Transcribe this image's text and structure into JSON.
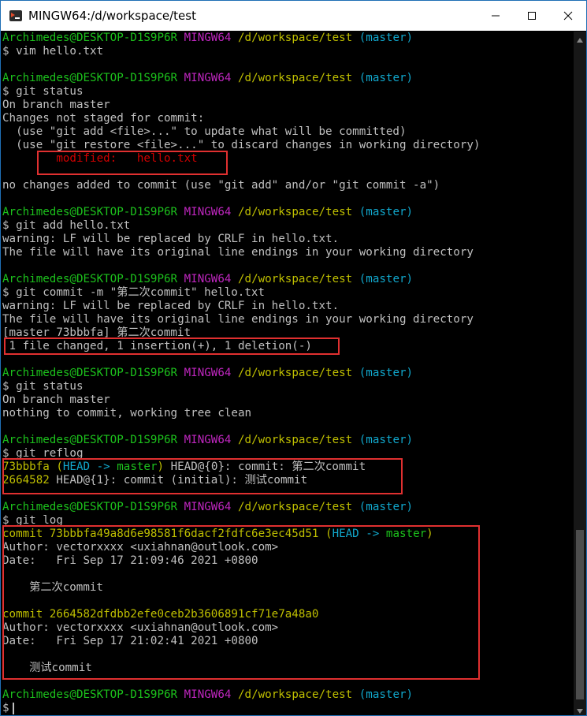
{
  "window": {
    "title": "MINGW64:/d/workspace/test"
  },
  "prompt": {
    "user": "Archimedes@DESKTOP-D1S9P6R",
    "env": "MINGW64",
    "path": "/d/workspace/test",
    "branch": "(master)",
    "symbol": "$"
  },
  "lines": {
    "c1": "$ vim hello.txt",
    "c2": "$ git status",
    "s1": "On branch master",
    "s2": "Changes not staged for commit:",
    "s3": "  (use \"git add <file>...\" to update what will be committed)",
    "s4": "  (use \"git restore <file>...\" to discard changes in working directory)",
    "s5": "        modified:   hello.txt",
    "s6": "no changes added to commit (use \"git add\" and/or \"git commit -a\")",
    "c3": "$ git add hello.txt",
    "w1": "warning: LF will be replaced by CRLF in hello.txt.",
    "w2": "The file will have its original line endings in your working directory",
    "c4": "$ git commit -m \"第二次commit\" hello.txt",
    "w3": "warning: LF will be replaced by CRLF in hello.txt.",
    "w4": "The file will have its original line endings in your working directory",
    "m1": "[master 73bbbfa] 第二次commit",
    "m2": " 1 file changed, 1 insertion(+), 1 deletion(-)",
    "c5": "$ git status",
    "t1": "On branch master",
    "t2": "nothing to commit, working tree clean",
    "c6": "$ git reflog",
    "r1_hash": "73bbbfa",
    "r1_open": " (",
    "r1_head": "HEAD -> ",
    "r1_branch": "master",
    "r1_close": ")",
    "r1_rest": " HEAD@{0}: commit: 第二次commit",
    "r2_hash": "2664582",
    "r2_rest": " HEAD@{1}: commit (initial): 测试commit",
    "c7": "$ git log",
    "l1_commit": "commit 73bbbfa49a8d6e98581f6dacf2fdfc6e3ec45d51",
    "l1_open": " (",
    "l1_head": "HEAD -> ",
    "l1_branch": "master",
    "l1_close": ")",
    "l1_author": "Author: vectorxxxx <uxiahnan@outlook.com>",
    "l1_date": "Date:   Fri Sep 17 21:09:46 2021 +0800",
    "l1_msg": "    第二次commit",
    "l2_commit": "commit 2664582dfdbb2efe0ceb2b3606891cf71e7a48a0",
    "l2_author": "Author: vectorxxxx <uxiahnan@outlook.com>",
    "l2_date": "Date:   Fri Sep 17 21:02:41 2021 +0800",
    "l2_msg": "    测试commit",
    "c8": "$"
  },
  "colors": {
    "prompt_user": "#1cc11c",
    "prompt_env": "#bf26bf",
    "prompt_path": "#bfbf00",
    "prompt_branch": "#11a8cd",
    "modified": "#d20000",
    "highlight_box": "#e03030",
    "terminal_bg": "#000000",
    "terminal_fg": "#c0c0c0"
  },
  "icons": {
    "app": "git-bash-icon",
    "minimize": "minimize-icon",
    "maximize": "maximize-icon",
    "close": "close-icon",
    "scroll_up": "scroll-up-arrow-icon",
    "scroll_down": "scroll-down-arrow-icon"
  }
}
